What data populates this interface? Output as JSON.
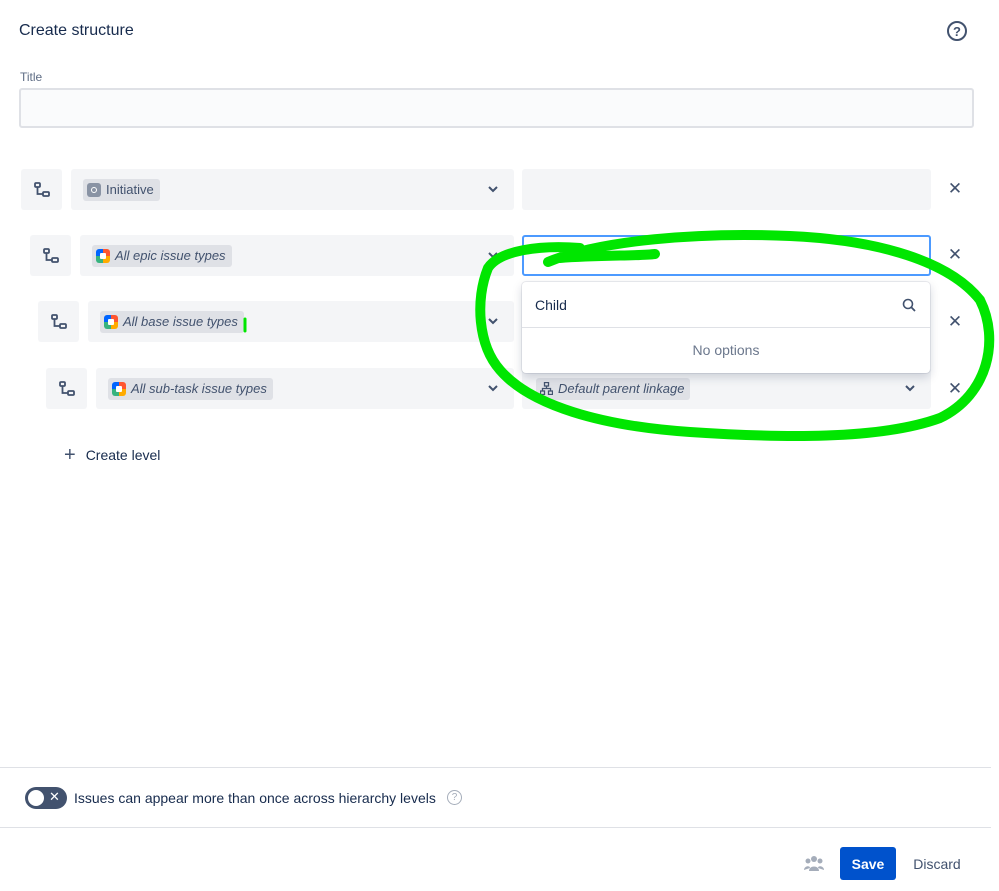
{
  "header": {
    "title": "Create structure",
    "help_glyph": "?"
  },
  "title_field": {
    "label": "Title",
    "value": "",
    "placeholder": ""
  },
  "levels": [
    {
      "issue_type": "Initiative",
      "icon": "initiative-icon",
      "linkage": ""
    },
    {
      "issue_type": "All epic issue types",
      "icon": "multi-issue-type-icon",
      "linkage": ""
    },
    {
      "issue_type": "All base issue types",
      "icon": "multi-issue-type-icon",
      "linkage": ""
    },
    {
      "issue_type": "All sub-task issue types",
      "icon": "multi-issue-type-icon",
      "linkage": "Default parent linkage"
    }
  ],
  "dropdown": {
    "search_value": "Child",
    "empty_text": "No options"
  },
  "create_level_label": "Create level",
  "footer": {
    "toggle_label": "Issues can appear more than once across hierarchy levels",
    "toggle_on": false,
    "save_label": "Save",
    "discard_label": "Discard"
  },
  "colors": {
    "primary": "#0052cc",
    "focus": "#4c9aff",
    "annotation": "#00e600"
  }
}
